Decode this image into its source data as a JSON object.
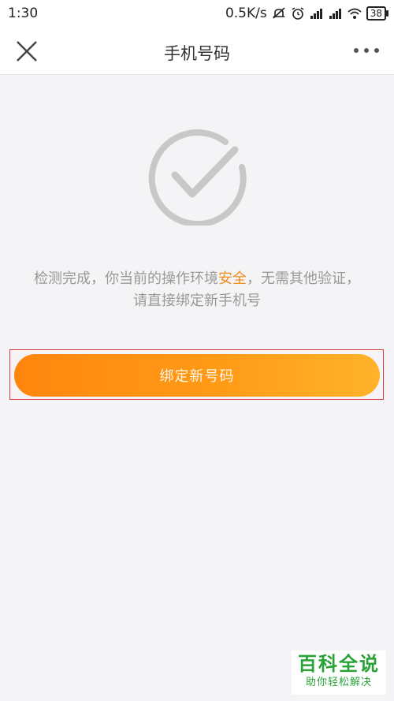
{
  "status_bar": {
    "time": "1:30",
    "speed": "0.5K/s",
    "battery": "38",
    "icons": [
      "mute-icon",
      "alarm-icon",
      "signal-icon",
      "wifi-icon",
      "battery-icon"
    ]
  },
  "nav": {
    "title": "手机号码",
    "close_icon": "close-icon",
    "more_icon": "more-icon"
  },
  "main": {
    "check_icon": "check-circle-icon",
    "message_prefix": "检测完成，你当前的操作环境",
    "message_highlight": "安全",
    "message_suffix": "，无需其他验证，",
    "message_line2": "请直接绑定新手机号",
    "button_label": "绑定新号码"
  },
  "watermark": {
    "title": "百科全说",
    "subtitle": "助你轻松解决"
  },
  "colors": {
    "accent": "#f08c19",
    "button_start": "#ff860e",
    "button_end": "#ffb32a",
    "background": "#f4f3f6",
    "check_gray": "#c8c8c8",
    "watermark_green": "#2aa238"
  }
}
